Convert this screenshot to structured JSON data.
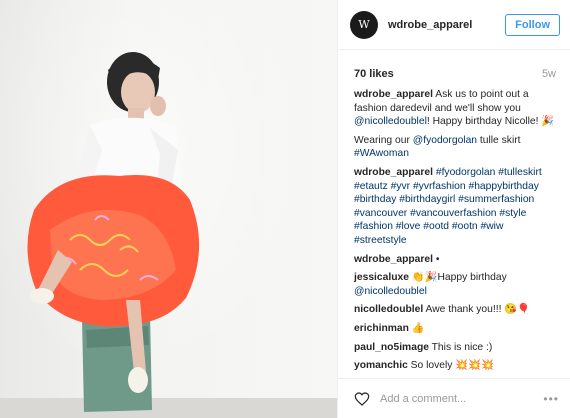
{
  "account": {
    "username": "wdrobe_apparel",
    "avatar_text": "W",
    "follow_label": "Follow"
  },
  "stats": {
    "likes": "70 likes",
    "age": "5w"
  },
  "caption": {
    "user": "wdrobe_apparel",
    "text1": " Ask us to point out a fashion daredevil and we'll show you ",
    "mention1": "@nicolledoublel",
    "text2": "! Happy birthday Nicolle! 🎉",
    "text3": "Wearing our ",
    "mention2": "@fyodorgolan",
    "text4": " tulle skirt ",
    "tag1": "#WAwoman"
  },
  "hashtags": {
    "user": "wdrobe_apparel",
    "tags": "#fyodorgolan #tulleskirt #etautz #yvr #yvrfashion #happybirthday #birthday #birthdaygirl #summerfashion #vancouver #vancouverfashion #style #fashion #love #ootd #ootn #wiw #streetstyle"
  },
  "comments": [
    {
      "user": "wdrobe_apparel",
      "text": " •"
    },
    {
      "user": "jessicaluxe",
      "text": " 👏🎉Happy birthday",
      "mention": "@nicolledoublel"
    },
    {
      "user": "nicolledoublel",
      "text": " Awe thank you!!! 😘🎈"
    },
    {
      "user": "erichinman",
      "text": " 👍"
    },
    {
      "user": "paul_no5image",
      "text": " This is nice :)"
    },
    {
      "user": "yomanchic",
      "text": " So lovely 💥💥💥"
    }
  ],
  "add_comment": {
    "placeholder": "Add a comment...",
    "more": "•••"
  },
  "colors": {
    "accent": "#3897f0",
    "tag": "#003569",
    "skirt": "#ff5a3c"
  },
  "icons": [
    "heart-icon",
    "more-options-icon"
  ]
}
